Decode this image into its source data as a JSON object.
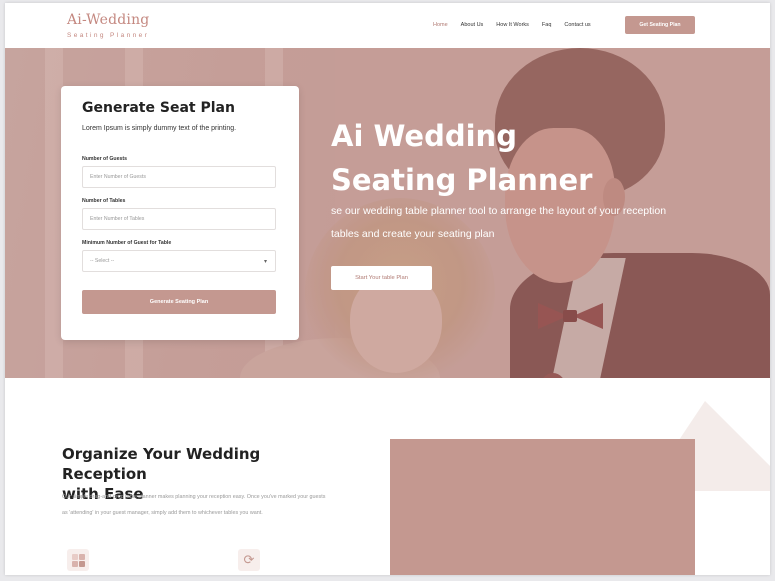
{
  "brand": {
    "logo_main": "Ai-Wedding",
    "logo_sub": "Seating Planner",
    "accent_color": "#c49890",
    "hero_color": "#c7a29c"
  },
  "nav": {
    "items": [
      {
        "label": "Home",
        "active": true
      },
      {
        "label": "About Us",
        "active": false
      },
      {
        "label": "How It Works",
        "active": false
      },
      {
        "label": "Faq",
        "active": false
      },
      {
        "label": "Contact us",
        "active": false
      }
    ],
    "cta_label": "Get Seating Plan"
  },
  "hero": {
    "title_line1": "Ai Wedding",
    "title_line2": "Seating Planner",
    "description": "se our wedding table planner tool to arrange the layout of your reception tables and create your seating plan",
    "button_label": "Start Your table Plan"
  },
  "form": {
    "title": "Generate Seat Plan",
    "subtitle": "Lorem Ipsum is simply dummy text of the printing.",
    "guests_label": "Number of Guests",
    "guests_placeholder": "Enter Number of Guests",
    "tables_label": "Number of Tables",
    "tables_placeholder": "Enter Number of Tables",
    "min_label": "Minimum Number of Guest for Table",
    "min_selected": "-- Select --",
    "submit_label": "Generate Seating Plan"
  },
  "section": {
    "title_line1": "Organize Your Wedding Reception",
    "title_line2": "with Ease",
    "text": "Our simple drag-and-drop table planner makes planning your reception easy. Once you've marked your guests as 'attending' in your guest manager, simply add them to whichever tables you want.",
    "icons": [
      "grid-icon",
      "refresh-icon"
    ]
  }
}
